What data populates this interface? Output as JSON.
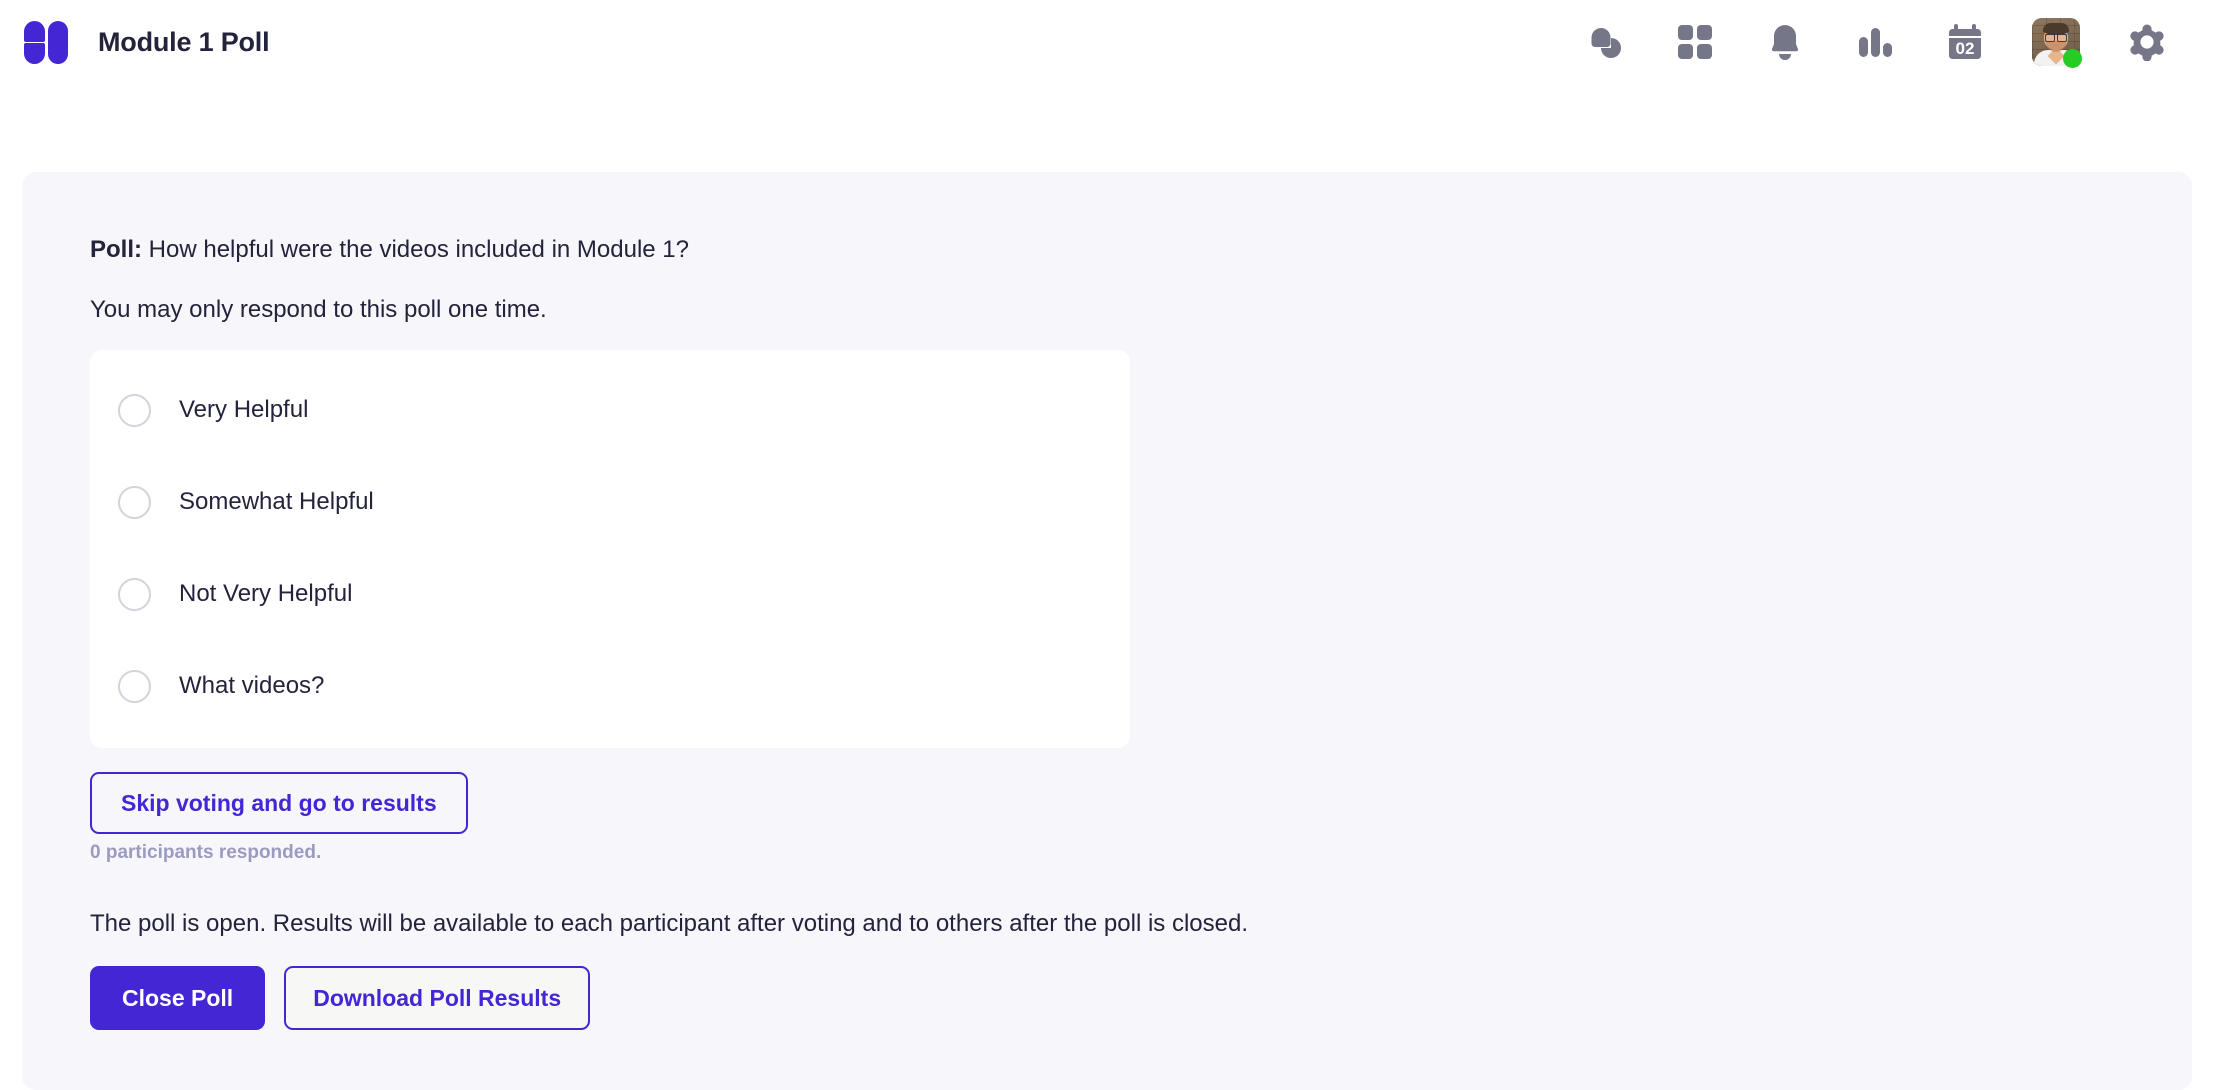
{
  "theme": {
    "brand_purple": "#4526d4",
    "panel_bg": "#f6f6fb",
    "card_bg": "#ffffff",
    "text_dark": "#23233c",
    "muted_purple": "#9b9bc0",
    "icon_gray": "#767689",
    "status_green": "#24cc24"
  },
  "topbar": {
    "logo_name": "app-logo",
    "title": "Module 1 Poll",
    "icons": [
      {
        "name": "chat-icon",
        "label": "Chat"
      },
      {
        "name": "apps-grid-icon",
        "label": "Apps"
      },
      {
        "name": "bell-icon",
        "label": "Notifications"
      },
      {
        "name": "bar-chart-icon",
        "label": "Analytics"
      },
      {
        "name": "calendar-icon",
        "label": "Calendar",
        "day": "02"
      },
      {
        "name": "avatar",
        "label": "Profile",
        "status": "online"
      },
      {
        "name": "gear-icon",
        "label": "Settings"
      }
    ]
  },
  "poll": {
    "lead": "Poll:",
    "question": "How helpful were the videos included in Module 1?",
    "subnote": "You may only respond to this poll one time.",
    "options": [
      {
        "label": "Very Helpful",
        "selected": false
      },
      {
        "label": "Somewhat Helpful",
        "selected": false
      },
      {
        "label": "Not Very Helpful",
        "selected": false
      },
      {
        "label": "What videos?",
        "selected": false
      }
    ],
    "skip_label": "Skip voting and go to results",
    "responded_text": "0 participants responded.",
    "status_text": "The poll is open. Results will be available to each participant after voting and to others after the poll is closed.",
    "close_label": "Close Poll",
    "download_label": "Download Poll Results"
  }
}
